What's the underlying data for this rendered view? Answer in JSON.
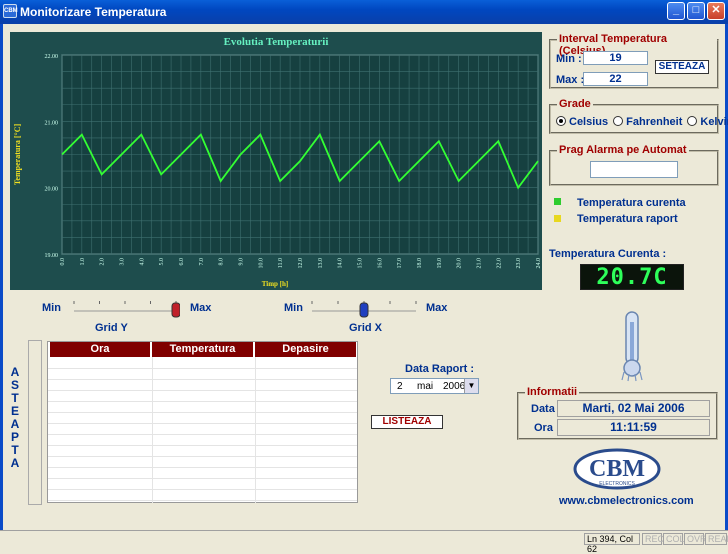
{
  "window": {
    "title": "Monitorizare Temperatura",
    "app_icon": "CBM"
  },
  "chart_data": {
    "type": "line",
    "title": "Evolutia Temperaturii",
    "xlabel": "Timp [h]",
    "ylabel": "Temperatura [°C]",
    "ylim": [
      19.0,
      22.0
    ],
    "xlim": [
      0.0,
      24.0
    ],
    "yticks": [
      "22.00",
      "21.00",
      "20.00",
      "19.00"
    ],
    "xticks": [
      "0.0",
      "1.0",
      "2.0",
      "3.0",
      "4.0",
      "5.0",
      "6.0",
      "7.0",
      "8.0",
      "9.0",
      "10.0",
      "11.0",
      "12.0",
      "13.0",
      "14.0",
      "15.0",
      "16.0",
      "17.0",
      "18.0",
      "19.0",
      "20.0",
      "21.0",
      "22.0",
      "23.0",
      "24.0"
    ],
    "grid": true,
    "series": [
      {
        "color": "#33ff33",
        "x": [
          0,
          1,
          2,
          3,
          4,
          5,
          6,
          7,
          8,
          9,
          10,
          11,
          12,
          13,
          14,
          15,
          16,
          17,
          18,
          19,
          20,
          21,
          22,
          23,
          24
        ],
        "y": [
          20.5,
          20.8,
          20.2,
          20.5,
          20.8,
          20.2,
          20.5,
          20.8,
          20.1,
          20.5,
          20.8,
          20.1,
          20.4,
          20.8,
          20.1,
          20.4,
          20.7,
          20.1,
          20.4,
          20.7,
          20.1,
          20.4,
          20.7,
          20.0,
          20.4
        ]
      }
    ]
  },
  "sliders": {
    "y": {
      "min_label": "Min",
      "max_label": "Max",
      "caption": "Grid Y",
      "value": 1.0
    },
    "x": {
      "min_label": "Min",
      "max_label": "Max",
      "caption": "Grid X",
      "value": 0.5
    }
  },
  "interval": {
    "legend": "Interval Temperatura (Celsius)",
    "min_label": "Min :",
    "min_value": "19",
    "max_label": "Max :",
    "max_value": "22",
    "button": "SETEAZA"
  },
  "grade": {
    "legend": "Grade",
    "options": [
      "Celsius",
      "Fahrenheit",
      "Kelvin"
    ],
    "selected": "Celsius"
  },
  "alarm": {
    "legend": "Prag Alarma pe Automat",
    "value": ""
  },
  "legend": [
    {
      "label": "Temperatura curenta",
      "color": "#2ecc2e"
    },
    {
      "label": "Temperatura raport",
      "color": "#e8d820"
    }
  ],
  "current": {
    "label": "Temperatura Curenta :",
    "value": "20.7C"
  },
  "table": {
    "headers": [
      "Ora",
      "Temperatura",
      "Depasire"
    ],
    "rows": []
  },
  "status_side": "ASTEAPTA",
  "report": {
    "label": "Data Raport :",
    "day": "2",
    "month": "mai",
    "year": "2006",
    "button": "LISTEAZA"
  },
  "info": {
    "legend": "Informatii",
    "date_label": "Data",
    "date_value": "Marti, 02 Mai 2006",
    "time_label": "Ora",
    "time_value": "11:11:59"
  },
  "brand": {
    "logo": "CBM",
    "logo_sub": "ELECTRONICS",
    "url": "www.cbmelectronics.com"
  },
  "statusbar": {
    "position": "Ln 394, Col 62",
    "flags": [
      "REC",
      "COL",
      "OVR",
      "READ"
    ]
  }
}
